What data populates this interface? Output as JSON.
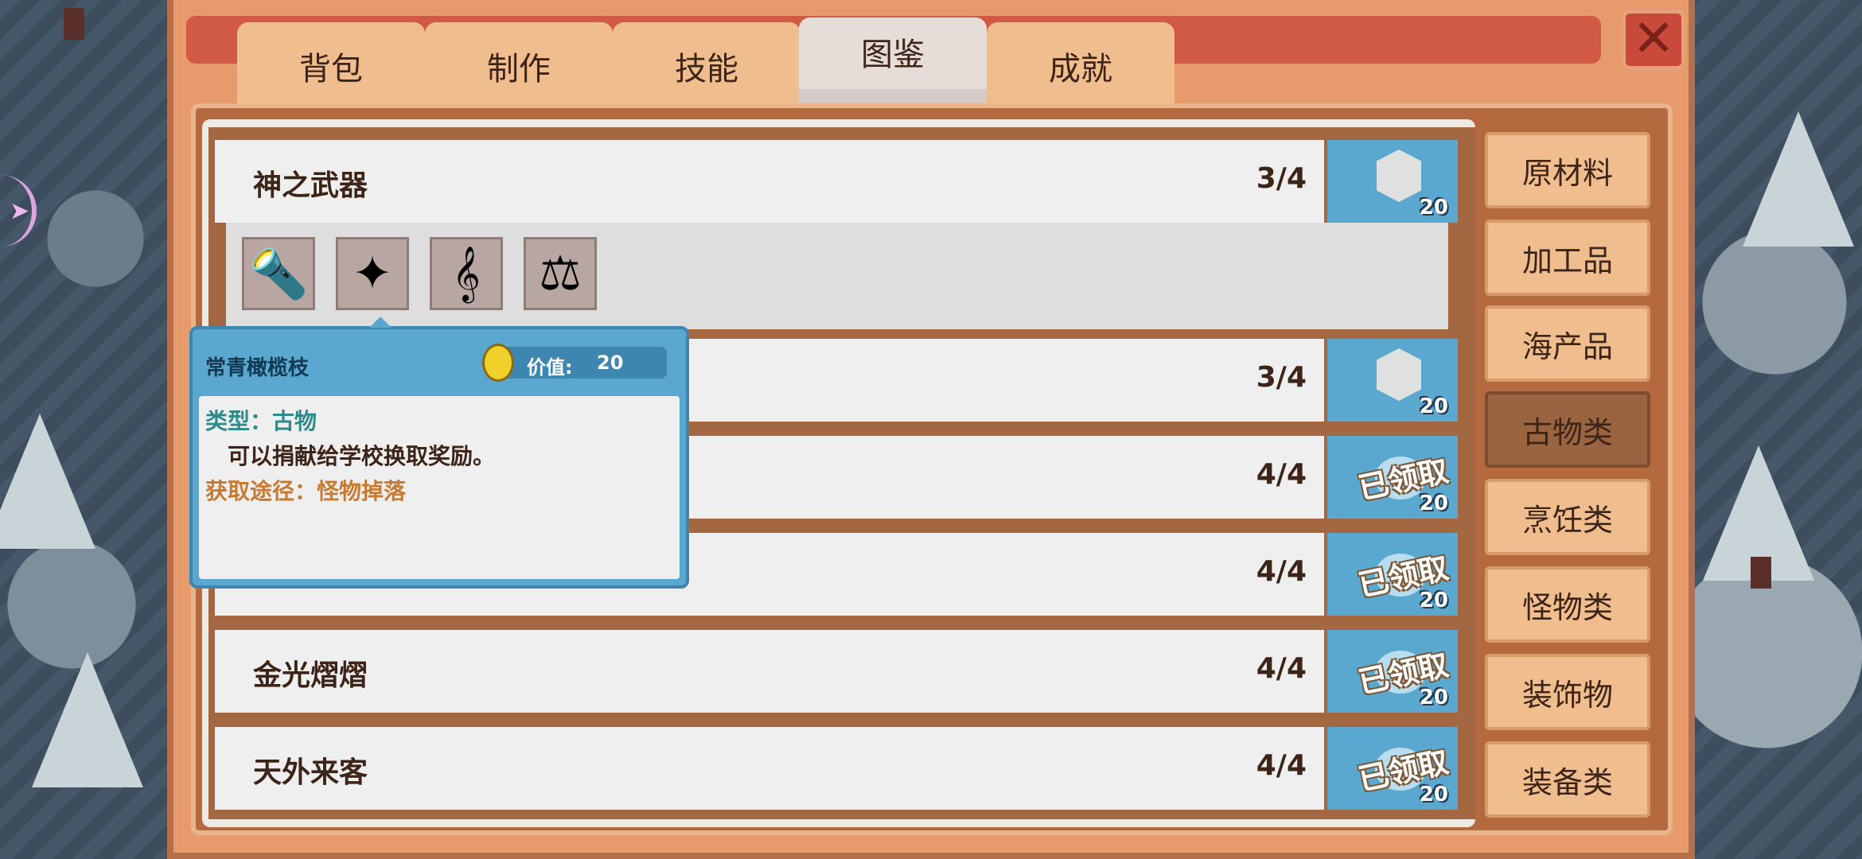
{
  "tabs": [
    {
      "label": "背包",
      "active": false
    },
    {
      "label": "制作",
      "active": false
    },
    {
      "label": "技能",
      "active": false
    },
    {
      "label": "图鉴",
      "active": true
    },
    {
      "label": "成就",
      "active": false
    }
  ],
  "collections": [
    {
      "name": "神之武器",
      "count": "3/4",
      "reward_qty": "20",
      "claimed": false
    },
    {
      "name": "",
      "count": "3/4",
      "reward_qty": "20",
      "claimed": false
    },
    {
      "name": "",
      "count": "4/4",
      "reward_qty": "20",
      "claimed": true
    },
    {
      "name": "",
      "count": "4/4",
      "reward_qty": "20",
      "claimed": true
    },
    {
      "name": "金光熠熠",
      "count": "4/4",
      "reward_qty": "20",
      "claimed": true
    },
    {
      "name": "天外来客",
      "count": "4/4",
      "reward_qty": "20",
      "claimed": true
    }
  ],
  "claimed_label": "已领取",
  "expanded_items": [
    {
      "icon": "torch-icon",
      "glyph": "🔦"
    },
    {
      "icon": "unknown-silhouette-icon",
      "glyph": "✦"
    },
    {
      "icon": "lyre-icon",
      "glyph": "𝄞"
    },
    {
      "icon": "scales-icon",
      "glyph": "⚖"
    }
  ],
  "categories": [
    {
      "label": "原材料",
      "active": false
    },
    {
      "label": "加工品",
      "active": false
    },
    {
      "label": "海产品",
      "active": false
    },
    {
      "label": "古物类",
      "active": true
    },
    {
      "label": "烹饪类",
      "active": false
    },
    {
      "label": "怪物类",
      "active": false
    },
    {
      "label": "装饰物",
      "active": false
    },
    {
      "label": "装备类",
      "active": false
    }
  ],
  "tooltip": {
    "item_name": "常青橄榄枝",
    "value_label": "价值:",
    "value": "20",
    "type_line": "类型：古物",
    "description": "可以捐献给学校换取奖励。",
    "source_line": "获取途径：怪物掉落"
  },
  "close_icon": "close-x-icon"
}
